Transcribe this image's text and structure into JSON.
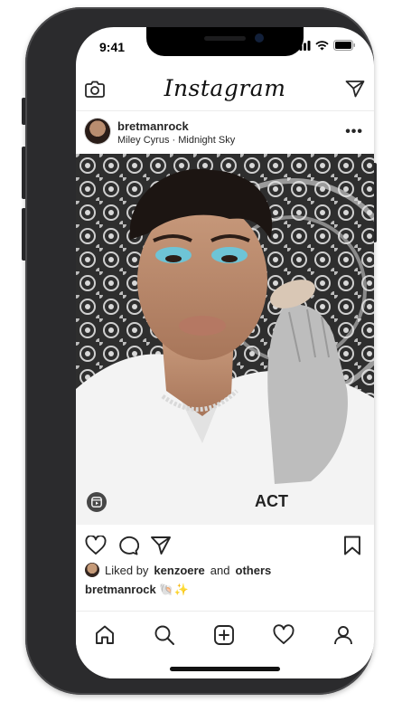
{
  "status_bar": {
    "time": "9:41"
  },
  "header": {
    "logo": "Instagram"
  },
  "post": {
    "username": "bretmanrock",
    "song": "Miley Cyrus · Midnight Sky",
    "more": "•••",
    "liked_prefix": "Liked by",
    "liked_user": "kenzoere",
    "liked_and": "and",
    "liked_others": "others",
    "caption_user": "bretmanrock",
    "caption_emoji": "🐚✨"
  },
  "icons": {
    "header": [
      "camera-icon",
      "direct-message-icon"
    ],
    "actions": [
      "heart-icon",
      "comment-icon",
      "share-icon",
      "bookmark-icon"
    ],
    "tabbar": [
      "home-icon",
      "search-icon",
      "new-post-icon",
      "activity-icon",
      "profile-icon"
    ]
  }
}
